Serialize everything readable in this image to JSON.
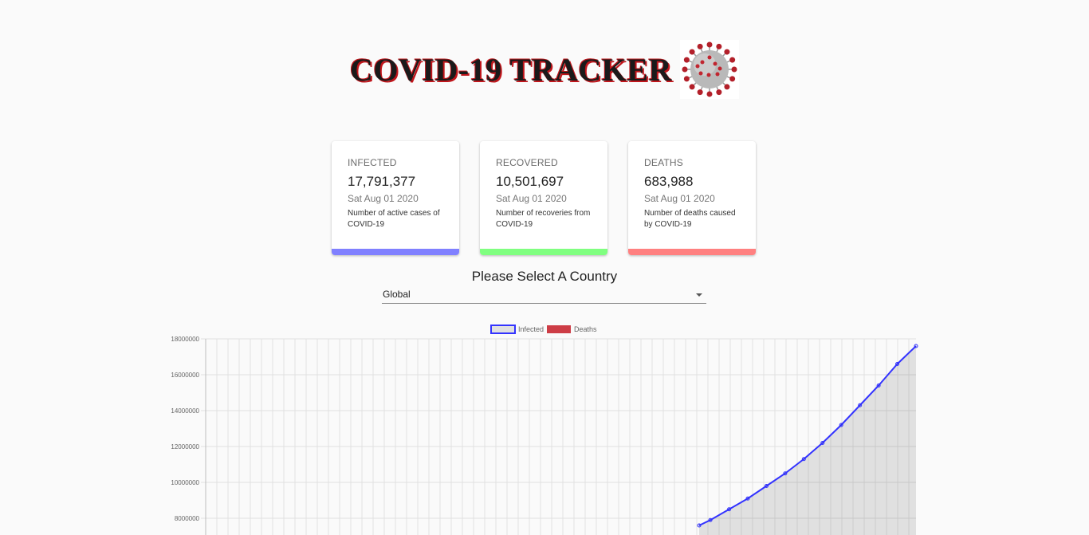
{
  "header": {
    "title": "COVID-19 TRACKER"
  },
  "cards": [
    {
      "label": "INFECTED",
      "value": "17,791,377",
      "date": "Sat Aug 01 2020",
      "description": "Number of active cases of COVID-19",
      "color": "#8080ff"
    },
    {
      "label": "RECOVERED",
      "value": "10,501,697",
      "date": "Sat Aug 01 2020",
      "description": "Number of recoveries from COVID-19",
      "color": "#80ff80"
    },
    {
      "label": "DEATHS",
      "value": "683,988",
      "date": "Sat Aug 01 2020",
      "description": "Number of deaths caused by COVID-19",
      "color": "#ff8080"
    }
  ],
  "country_picker": {
    "heading": "Please Select A Country",
    "selected": "Global"
  },
  "chart_data": {
    "type": "line",
    "title": "",
    "xlabel": "",
    "ylabel": "",
    "legend_position": "top-center",
    "grid": true,
    "ylim": [
      0,
      18000000
    ],
    "y_ticks": [
      18000000,
      16000000,
      14000000,
      12000000,
      10000000,
      8000000
    ],
    "series": [
      {
        "name": "Infected",
        "color": "#3333ff",
        "fill": "rgba(0,0,0,0.10)",
        "x_index_range": [
          0,
          190
        ],
        "values_tail": [
          [
            132,
            7600000
          ],
          [
            135,
            7900000
          ],
          [
            140,
            8500000
          ],
          [
            145,
            9100000
          ],
          [
            150,
            9800000
          ],
          [
            155,
            10500000
          ],
          [
            160,
            11300000
          ],
          [
            165,
            12200000
          ],
          [
            170,
            13200000
          ],
          [
            175,
            14300000
          ],
          [
            180,
            15400000
          ],
          [
            185,
            16600000
          ],
          [
            190,
            17600000
          ]
        ]
      },
      {
        "name": "Deaths",
        "color": "rgba(200,40,50,0.9)",
        "fill": "rgba(200,40,50,0.9)"
      }
    ]
  }
}
